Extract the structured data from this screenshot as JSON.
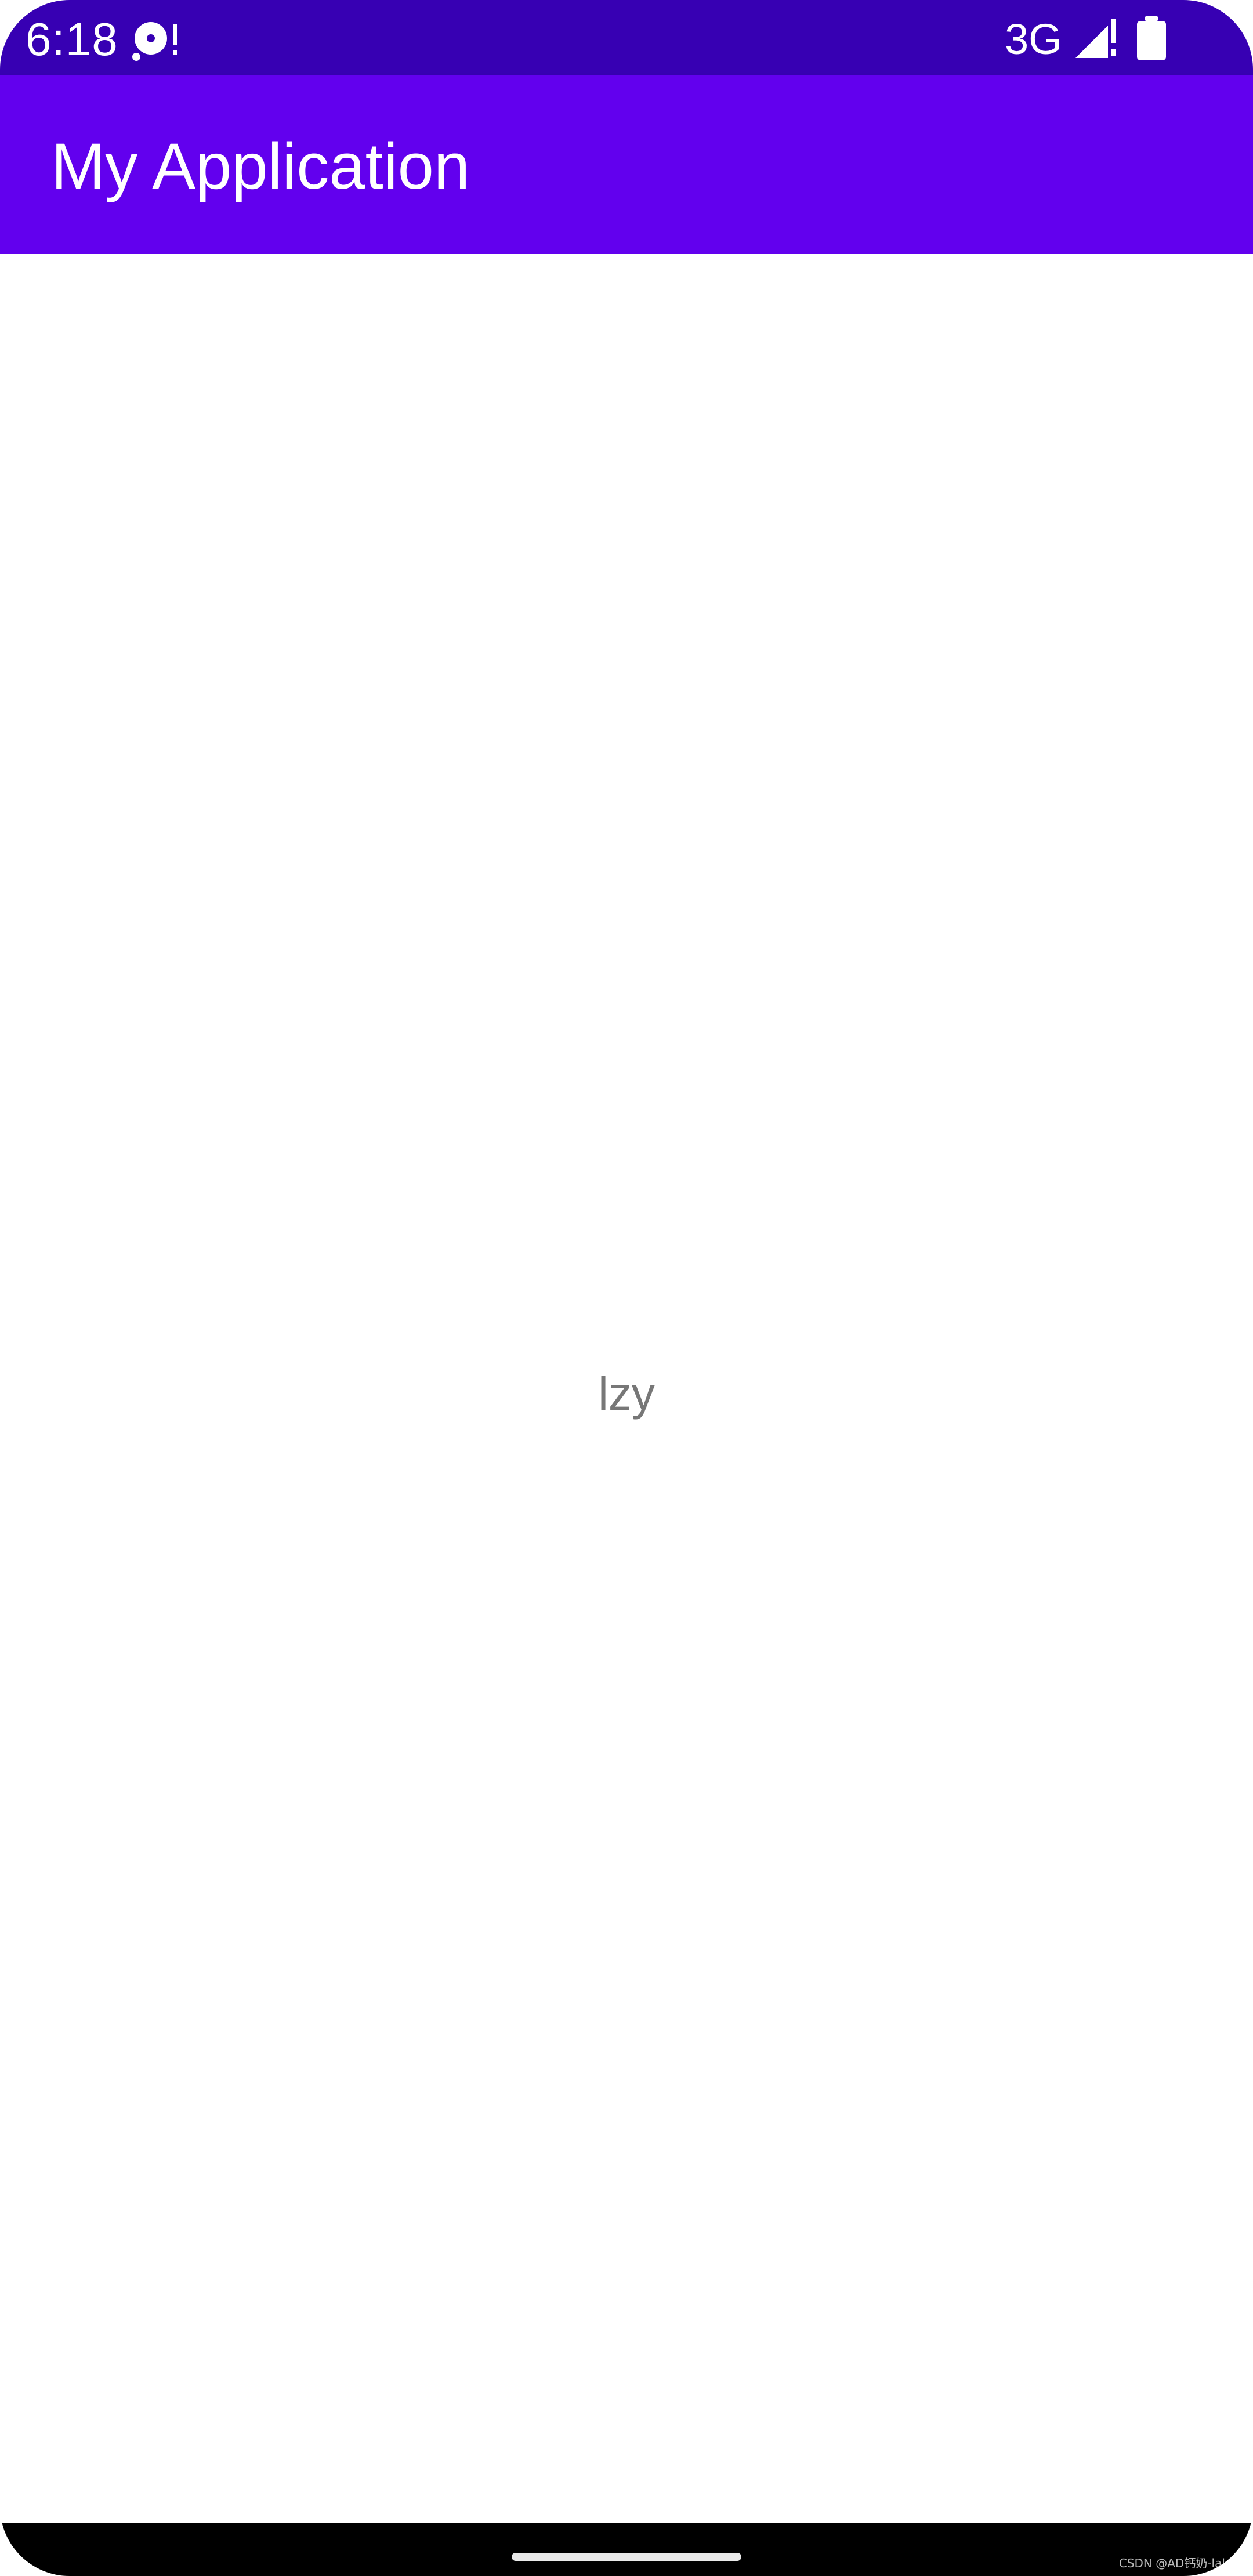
{
  "status_bar": {
    "time": "6:18",
    "network": "3G",
    "icons": {
      "left": "media-alert-icon",
      "signal": "cellular-signal-alert-icon",
      "battery": "battery-icon"
    },
    "background": "#3700B3"
  },
  "app_bar": {
    "title": "My Application",
    "background": "#6200EE"
  },
  "main": {
    "text": "lzy"
  },
  "nav_bar": {
    "watermark": "CSDN @AD钙奶-lalala",
    "background": "#000000"
  }
}
